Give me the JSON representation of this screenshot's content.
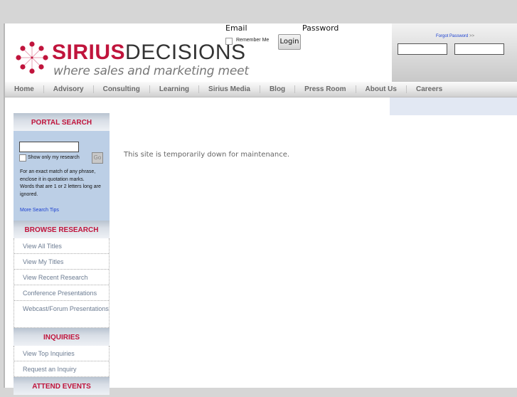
{
  "header": {
    "logo": {
      "brand_bold": "SIRIUS",
      "brand_light": "DECISIONS",
      "tagline": "where sales and marketing meet",
      "icon": "starburst-logo-icon"
    },
    "login": {
      "email_label": "Email",
      "password_label": "Password",
      "remember_label": "Remember Me",
      "login_button": "Login",
      "forgot_link": "Forgot Password",
      "forgot_arrows": ">>",
      "email_value": "",
      "password_value": ""
    }
  },
  "nav": {
    "items": [
      {
        "label": "Home"
      },
      {
        "label": "Advisory"
      },
      {
        "label": "Consulting"
      },
      {
        "label": "Learning"
      },
      {
        "label": "Sirius Media"
      },
      {
        "label": "Blog"
      },
      {
        "label": "Press Room"
      },
      {
        "label": "About Us"
      },
      {
        "label": "Careers"
      }
    ]
  },
  "sidebar": {
    "portal_search": {
      "title": "PORTAL SEARCH",
      "input_value": "",
      "only_mine_label": "Show only my research",
      "go_button": "Go",
      "help_text": "For an exact match of any phrase, enclose it in quotation marks.",
      "help_text_2": "Words that are 1 or 2 letters long are ignored.",
      "tips_link": "More Search Tips"
    },
    "browse_research": {
      "title": "BROWSE RESEARCH",
      "links": [
        {
          "label": "View All Titles"
        },
        {
          "label": "View My Titles"
        },
        {
          "label": "View Recent Research"
        },
        {
          "label": "Conference Presentations"
        },
        {
          "label": "Webcast/Forum Presentations"
        }
      ]
    },
    "inquiries": {
      "title": "INQUIRIES",
      "links": [
        {
          "label": "View Top Inquiries"
        },
        {
          "label": "Request an Inquiry"
        }
      ]
    },
    "attend_events": {
      "title": "ATTEND EVENTS"
    }
  },
  "main": {
    "message": "This site is temporarily down for maintenance."
  },
  "colors": {
    "brand_red": "#c0143c",
    "link_blue": "#1a3fd0",
    "sidebar_blue": "#bccfe6",
    "side_link": "#6c7c92"
  }
}
